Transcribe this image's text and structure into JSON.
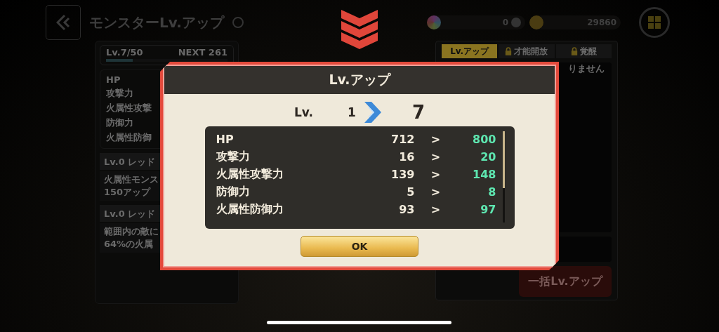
{
  "header": {
    "title": "モンスターLv.アップ",
    "currencies": [
      {
        "kind": "gem",
        "amount": "0"
      },
      {
        "kind": "coin",
        "amount": "29860"
      }
    ]
  },
  "level_card": {
    "level": "Lv.7/50",
    "next": "NEXT 261",
    "progress": {
      "level": 0.22
    }
  },
  "stat_labels": [
    "HP",
    "攻撃力",
    "火属性攻撃",
    "防御力",
    "火属性防御"
  ],
  "skills": [
    {
      "title": "Lv.0 レッド",
      "lines": [
        "火属性モンス",
        "150アップ"
      ]
    },
    {
      "title": "Lv.0 レッド",
      "lines": [
        "範囲内の敵に",
        "64%の火属"
      ]
    }
  ],
  "tabs": [
    {
      "label": "Lv.アップ",
      "selected": true,
      "locked": false
    },
    {
      "label": "才能開放",
      "selected": false,
      "locked": true
    },
    {
      "label": "覚醒",
      "selected": false,
      "locked": true
    }
  ],
  "right_panel": {
    "message": "りません",
    "bulk_button": "一括Lv.アップ"
  },
  "modal": {
    "title": "Lv.アップ",
    "level_label": "Lv.",
    "level_from": "1",
    "level_to": "7",
    "stats": [
      {
        "name": "HP",
        "from": "712",
        "arrow": ">",
        "to": "800"
      },
      {
        "name": "攻撃力",
        "from": "16",
        "arrow": ">",
        "to": "20"
      },
      {
        "name": "火属性攻撃力",
        "from": "139",
        "arrow": ">",
        "to": "148"
      },
      {
        "name": "防御力",
        "from": "5",
        "arrow": ">",
        "to": "8"
      },
      {
        "name": "火属性防御力",
        "from": "93",
        "arrow": ">",
        "to": "97"
      }
    ],
    "ok": "OK"
  }
}
